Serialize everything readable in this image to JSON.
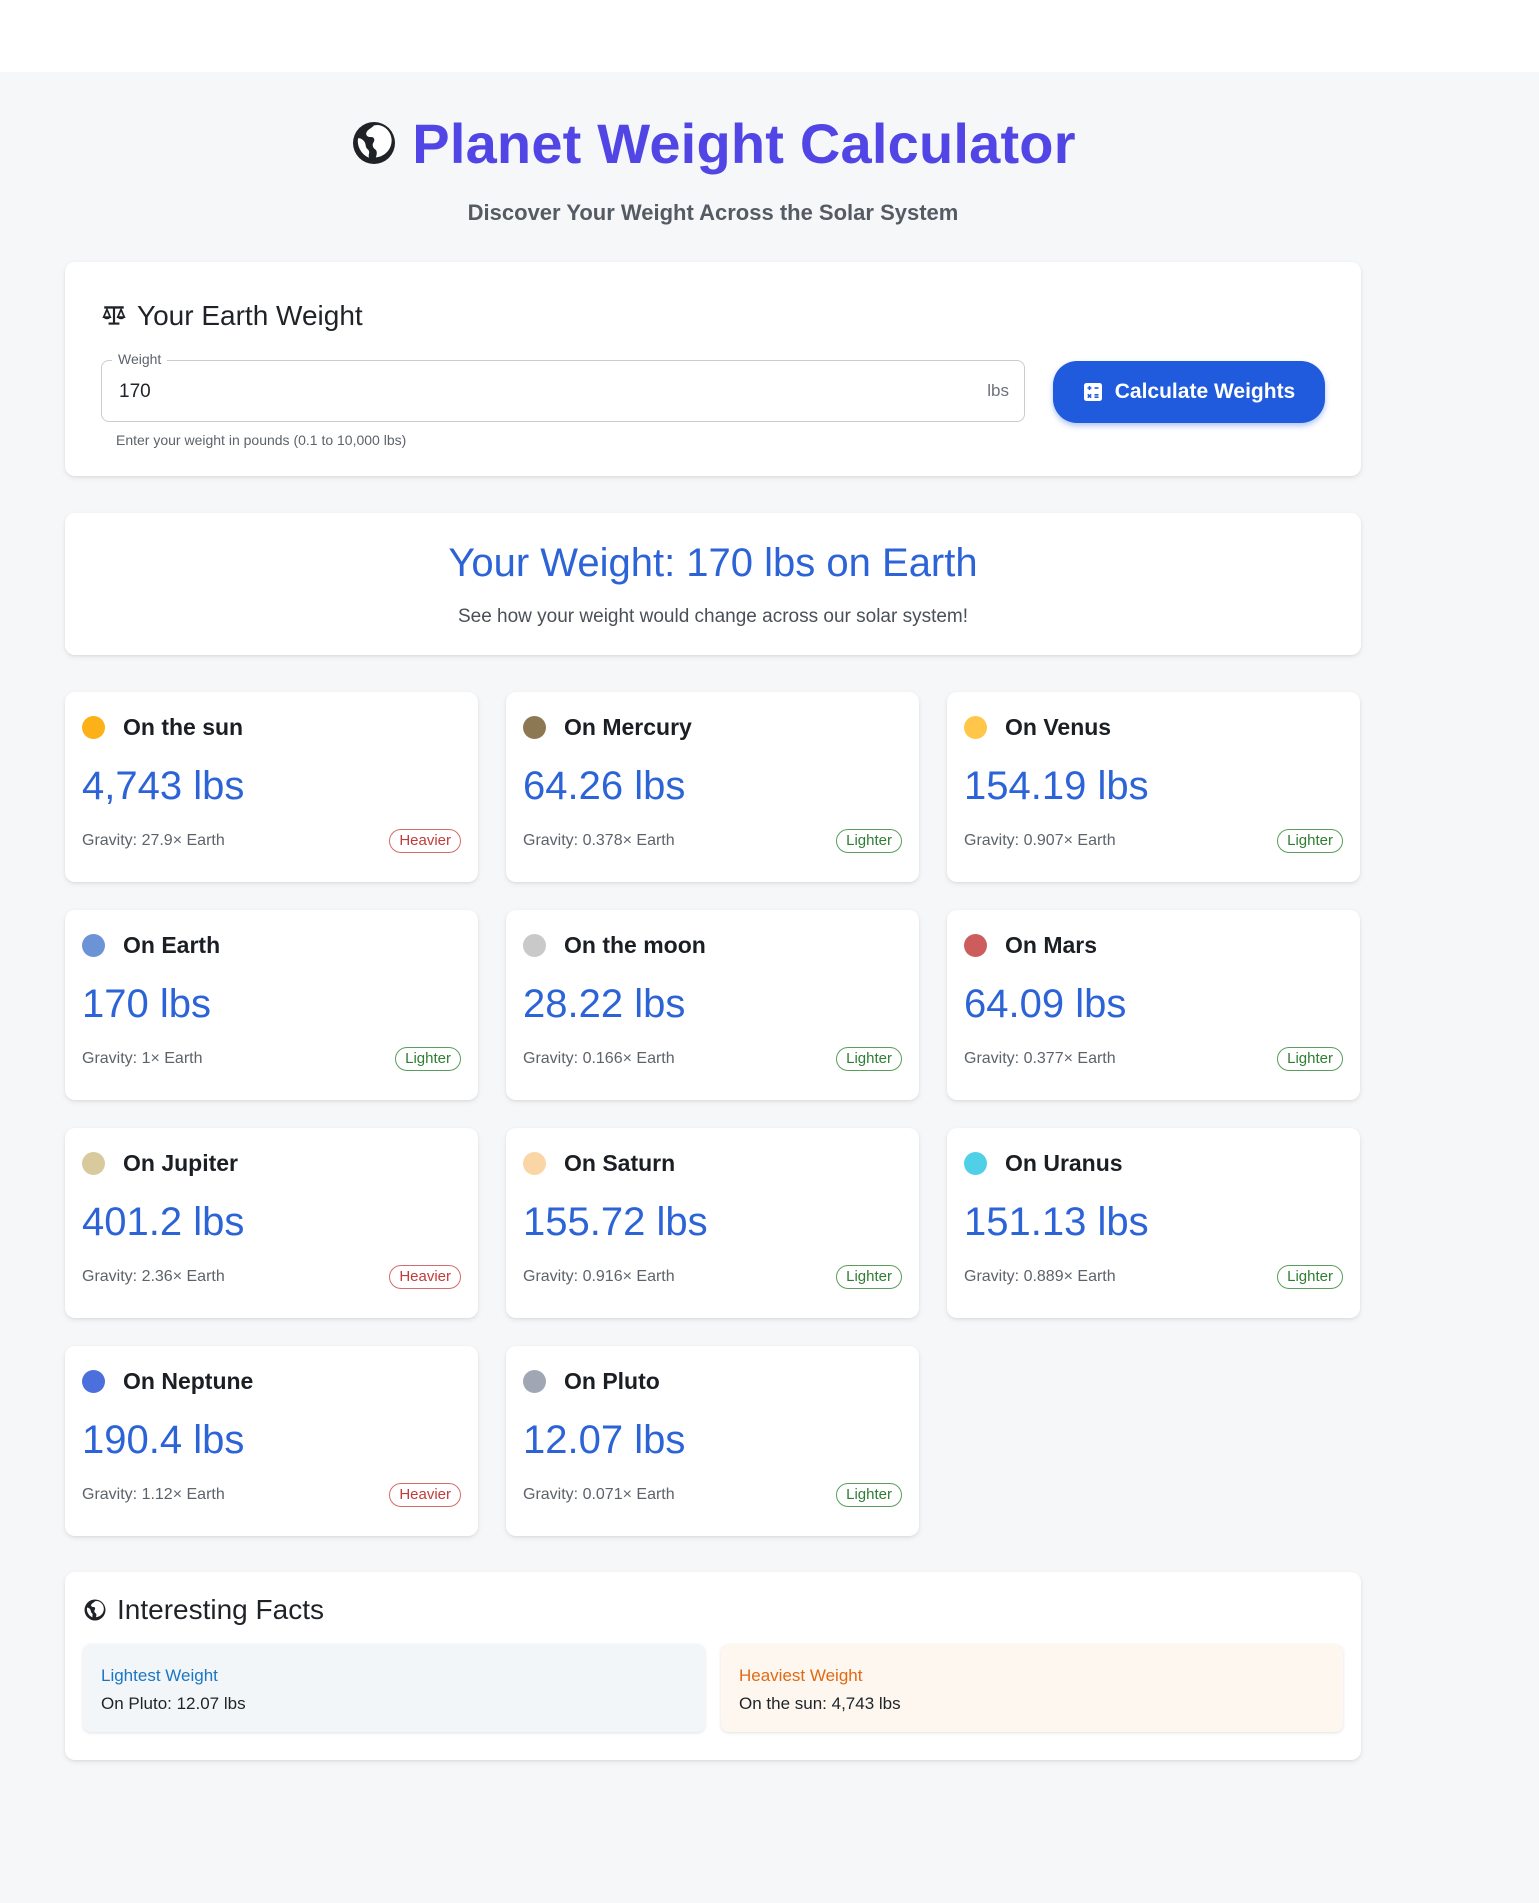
{
  "header": {
    "title": "Planet Weight Calculator",
    "subtitle": "Discover Your Weight Across the Solar System",
    "icon": "globe-icon"
  },
  "input_card": {
    "heading": "Your Earth Weight",
    "heading_icon": "scale-icon",
    "field_label": "Weight",
    "field_value": "170",
    "field_suffix": "lbs",
    "helper_text": "Enter your weight in pounds (0.1 to 10,000 lbs)",
    "button_label": "Calculate Weights",
    "button_icon": "calculator-icon",
    "button_color": "#1f5bdc"
  },
  "summary": {
    "title": "Your Weight: 170 lbs on Earth",
    "text": "See how your weight would change across our solar system!"
  },
  "planets": [
    {
      "name": "On the sun",
      "weight": "4,743 lbs",
      "gravity": "Gravity: 27.9× Earth",
      "badge": "Heavier",
      "color": "#fbb117"
    },
    {
      "name": "On Mercury",
      "weight": "64.26 lbs",
      "gravity": "Gravity: 0.378× Earth",
      "badge": "Lighter",
      "color": "#8c7853"
    },
    {
      "name": "On Venus",
      "weight": "154.19 lbs",
      "gravity": "Gravity: 0.907× Earth",
      "badge": "Lighter",
      "color": "#ffc649"
    },
    {
      "name": "On Earth",
      "weight": "170 lbs",
      "gravity": "Gravity: 1× Earth",
      "badge": "Lighter",
      "color": "#6b93d6"
    },
    {
      "name": "On the moon",
      "weight": "28.22 lbs",
      "gravity": "Gravity: 0.166× Earth",
      "badge": "Lighter",
      "color": "#c9c9c9"
    },
    {
      "name": "On Mars",
      "weight": "64.09 lbs",
      "gravity": "Gravity: 0.377× Earth",
      "badge": "Lighter",
      "color": "#cd5c5c"
    },
    {
      "name": "On Jupiter",
      "weight": "401.2 lbs",
      "gravity": "Gravity: 2.36× Earth",
      "badge": "Heavier",
      "color": "#d8ca9d"
    },
    {
      "name": "On Saturn",
      "weight": "155.72 lbs",
      "gravity": "Gravity: 0.916× Earth",
      "badge": "Lighter",
      "color": "#fad5a5"
    },
    {
      "name": "On Uranus",
      "weight": "151.13 lbs",
      "gravity": "Gravity: 0.889× Earth",
      "badge": "Lighter",
      "color": "#4fd0e7"
    },
    {
      "name": "On Neptune",
      "weight": "190.4 lbs",
      "gravity": "Gravity: 1.12× Earth",
      "badge": "Heavier",
      "color": "#4b70dd"
    },
    {
      "name": "On Pluto",
      "weight": "12.07 lbs",
      "gravity": "Gravity: 0.071× Earth",
      "badge": "Lighter",
      "color": "#a0a6b4"
    }
  ],
  "facts": {
    "heading": "Interesting Facts",
    "heading_icon": "globe-icon",
    "lightest_title": "Lightest Weight",
    "lightest_text": "On Pluto: 12.07 lbs",
    "heaviest_title": "Heaviest Weight",
    "heaviest_text": "On the sun: 4,743 lbs"
  }
}
